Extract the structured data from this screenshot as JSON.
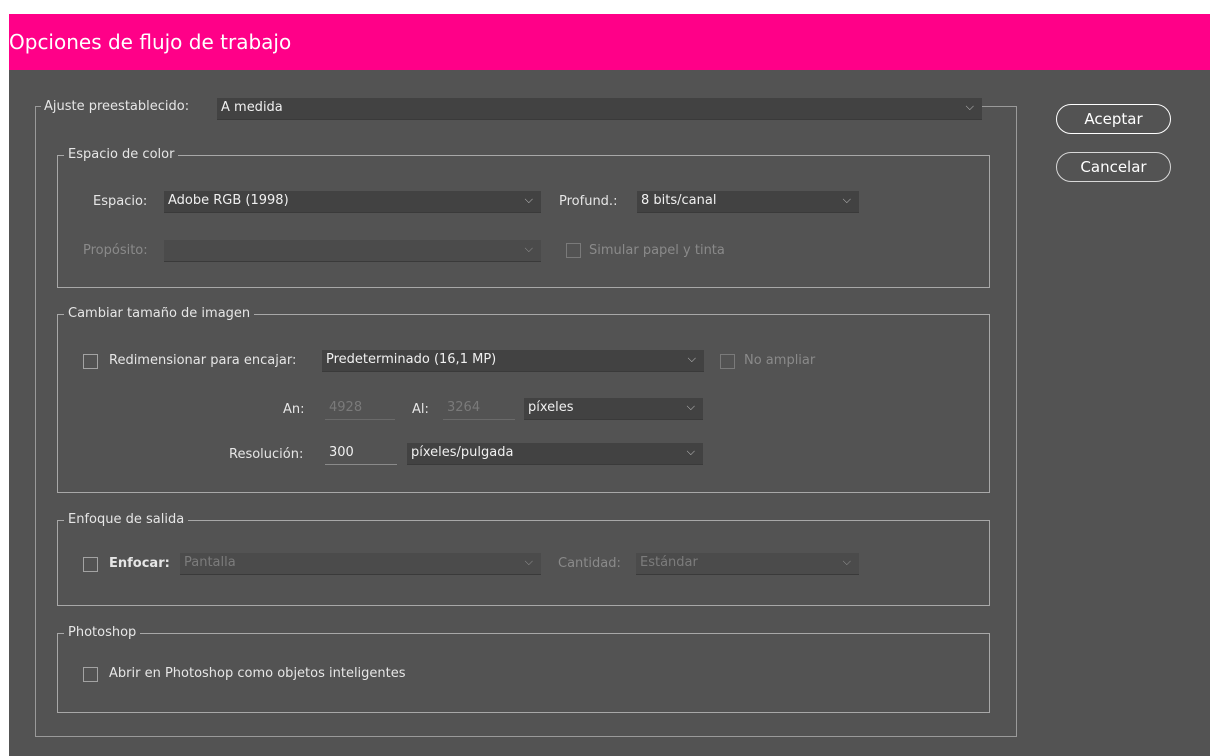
{
  "window": {
    "title": "Opciones de flujo de trabajo"
  },
  "preset": {
    "label": "Ajuste preestablecido:",
    "value": "A medida"
  },
  "buttons": {
    "accept": "Aceptar",
    "cancel": "Cancelar"
  },
  "color_space": {
    "title": "Espacio de color",
    "space_label": "Espacio:",
    "space_value": "Adobe RGB (1998)",
    "depth_label": "Profund.:",
    "depth_value": "8 bits/canal",
    "intent_label": "Propósito:",
    "intent_value": "",
    "simulate_label": "Simular papel y tinta"
  },
  "image_size": {
    "title": "Cambiar tamaño de imagen",
    "resize_label": "Redimensionar para encajar:",
    "resize_value": "Predeterminado (16,1 MP)",
    "no_enlarge_label": "No ampliar",
    "width_label": "An:",
    "width_value": "4928",
    "height_label": "Al:",
    "height_value": "3264",
    "units_value": "píxeles",
    "resolution_label": "Resolución:",
    "resolution_value": "300",
    "resolution_units": "píxeles/pulgada"
  },
  "sharpening": {
    "title": "Enfoque de salida",
    "sharpen_label": "Enfocar:",
    "sharpen_value": "Pantalla",
    "amount_label": "Cantidad:",
    "amount_value": "Estándar"
  },
  "photoshop": {
    "title": "Photoshop",
    "smart_objects_label": "Abrir en Photoshop como objetos inteligentes"
  },
  "icons": {
    "dropdown": "chevron-down-icon",
    "checkbox": "checkbox-unchecked"
  }
}
